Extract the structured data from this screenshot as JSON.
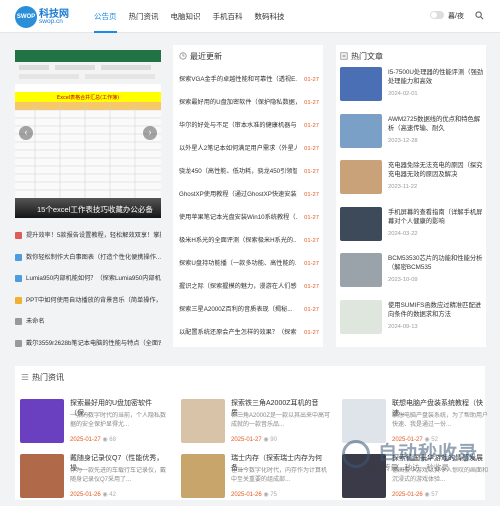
{
  "header": {
    "logo_cn": "科技网",
    "logo_url": "swop.cn",
    "nav": [
      "公告页",
      "热门资讯",
      "电脑知识",
      "手机百科",
      "数码科技"
    ],
    "mode": "暮/夜"
  },
  "slider": {
    "caption": "15个excel工作表技巧收藏办公必备",
    "sheet_title": "Excel表格合并汇总(工作簿)"
  },
  "left_list": [
    {
      "text": "提升效率！5款报告设置教程，轻松解效双享！掌握...",
      "color": "#e05a5a"
    },
    {
      "text": "数你轻松制作大白事图表（打造个性化便携操作...",
      "color": "#4a9de0"
    },
    {
      "text": "Lumia950内部机能如何？（探索Lumia950内部机...",
      "color": "#4a9de0"
    },
    {
      "text": "PPT中如何使用自动播放的背景音乐（简单操作，让...",
      "color": "#f0b030"
    },
    {
      "text": "未命名",
      "color": "#999999"
    },
    {
      "text": "戴尔3559r2628b笔记本电脑的性能与特点（全面评...",
      "color": "#999999"
    }
  ],
  "latest": {
    "title": "最近更新",
    "items": [
      {
        "t": "探索VGA金手的卓越性能和可靠性（透视E...",
        "d": "01-27"
      },
      {
        "t": "探索最好用的U盘加密软件（保护隐私数据，...",
        "d": "01-27"
      },
      {
        "t": "华尔的好处与不足（审本水准的健康机器与...",
        "d": "01-27"
      },
      {
        "t": "以外星人2笔记本如何满足用户需求（外星人...",
        "d": "01-27"
      },
      {
        "t": "骁龙450（高性能、低功耗，骁龙450引领智...",
        "d": "01-27"
      },
      {
        "t": "GhostXP使用教程（通过GhostXP快速安装...",
        "d": "01-27"
      },
      {
        "t": "使用苹果笔记本光盘安装Win10系统教程（...",
        "d": "01-27"
      },
      {
        "t": "极米H系光的全面评测（探索极米H系光的...",
        "d": "01-27"
      },
      {
        "t": "探索U盘持功能播（一款多功能、高性能的...",
        "d": "01-27"
      },
      {
        "t": "握识之际（探索握模的魅力，漫游在人们感...",
        "d": "01-27"
      },
      {
        "t": "探索三星A2000Z百利的音质表现（揭秘...",
        "d": "01-27"
      },
      {
        "t": "以配置系统还原会产生怎样的效果？（探索...",
        "d": "01-27"
      }
    ]
  },
  "hot_articles": {
    "title": "热门文章",
    "items": [
      {
        "t": "I5-7500U处理器的性能评测（强劲处理能力和高效",
        "d": "2024-02-01"
      },
      {
        "t": "AWM2725数据线的优点和特色解析（高速传输、耐久",
        "d": "2023-12-28"
      },
      {
        "t": "充电器免除无法充电的原因（探究充电器无效的原因及解决",
        "d": "2023-11-22"
      },
      {
        "t": "手机屏幕的查看指南（详解手机屏幕对个人健康的影响",
        "d": "2024-03-22"
      },
      {
        "t": "BCM53530芯片的功能和性能分析（解密BCM535",
        "d": "2023-10-09"
      },
      {
        "t": "使用SUMIFS函数应过精准匹配进向条件的数据求和方法",
        "d": "2024-09-13"
      }
    ]
  },
  "hot_news": {
    "title": "热门资讯",
    "cards": [
      {
        "t": "探索最好用的U盘加密软件（保...",
        "desc": "一张的数字时代的当前，个人隐私数据的安全保护显得尤...",
        "date": "2025-01-27",
        "views": "68"
      },
      {
        "t": "探索铁三角A2000Z耳机的音质...",
        "desc": "铁三角A2000Z是一款以其出来中高可成就的一款音乐品...",
        "date": "2025-01-27",
        "views": "90"
      },
      {
        "t": "联想电脑产盘装系统教程（快速...",
        "desc": "联想电脑产盘装系统，为了帮助用户快速、我是通过一份...",
        "date": "2025-01-27",
        "views": "52"
      },
      {
        "t": "戴随身记录仪Q7（性能优秀，操...",
        "desc": "作为一款先进的车载行车记录仪，戴随身记录仪Q7采用了...",
        "date": "2025-01-26",
        "views": "42"
      },
      {
        "t": "瑞士内存（探索瑞士内存为何备...",
        "desc": "在当今数字化时代，内存作为计算机中至关重要的组成部...",
        "date": "2025-01-26",
        "views": "75"
      },
      {
        "t": "探索德国豪华游戏的情感发展（...",
        "desc": "德国豪华游戏以其令人惊叹的画面和沉浸式的游戏体验...",
        "date": "2025-01-26",
        "views": "57"
      }
    ]
  },
  "watermark": {
    "big": "自动秒收录",
    "small": "随上传量 · 秒访 · 秒收录"
  }
}
